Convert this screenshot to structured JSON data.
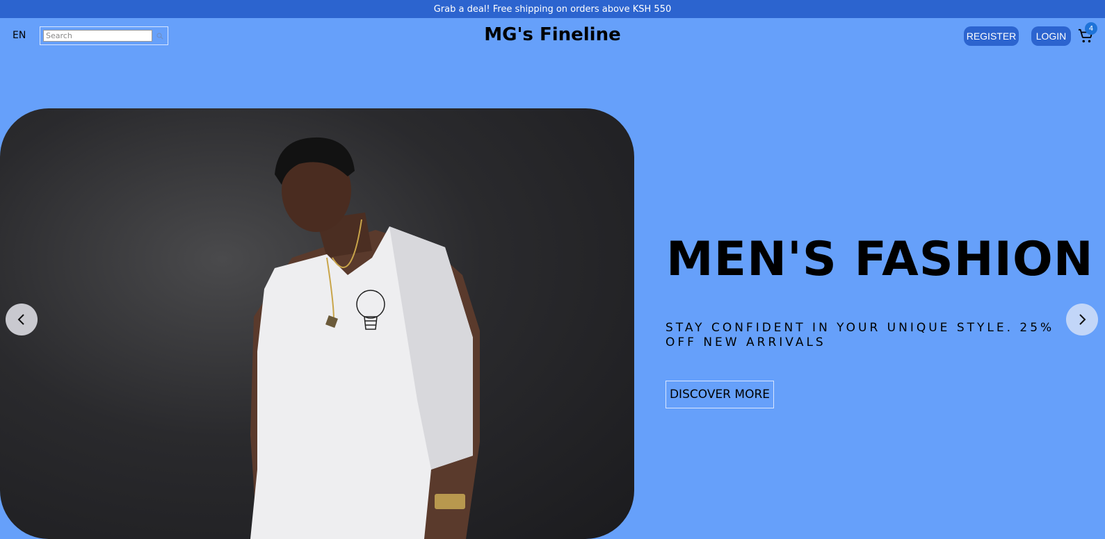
{
  "announcement": {
    "text": "Grab a deal! Free shipping on orders above KSH 550"
  },
  "header": {
    "language": "EN",
    "search_placeholder": "Search",
    "logo": "MG's Fineline",
    "register_label": "REGISTER",
    "login_label": "LOGIN",
    "cart_count": "4"
  },
  "hero": {
    "title": "MEN'S FASHION",
    "subtitle": "STAY CONFIDENT IN YOUR UNIQUE STYLE. 25% OFF NEW ARRIVALS",
    "cta_label": "DISCOVER MORE"
  },
  "icons": {
    "search": "search-icon",
    "cart": "shopping-cart-icon",
    "prev": "chevron-left-icon",
    "next": "chevron-right-icon"
  },
  "colors": {
    "background": "#66a0fa",
    "accent": "#2c64cf",
    "badge": "#1e73d8"
  }
}
